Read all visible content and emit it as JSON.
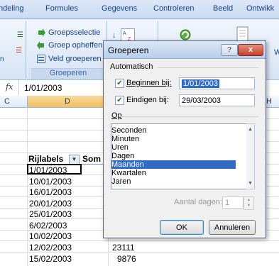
{
  "ribbon": {
    "tabs": [
      "ndeling",
      "Formules",
      "Gegevens",
      "Controleren",
      "Beeld",
      "Ontwikk"
    ],
    "buttons": {
      "groepsselectie": "Groepsselectie",
      "groep_opheffen": "Groep opheffen",
      "veld_groeperen": "Veld groeperen"
    },
    "group_label": "Groeperen",
    "partial_label_right": "W"
  },
  "formula_bar": {
    "fx": "fx",
    "value": "1/01/2003"
  },
  "sheet": {
    "columns": [
      "C",
      "D",
      "H"
    ],
    "pivot_header": {
      "row_labels": "Rijlabels",
      "sum": "Som"
    },
    "dates": [
      "1/01/2003",
      "10/01/2003",
      "16/01/2003",
      "20/01/2003",
      "25/01/2003",
      "6/02/2003",
      "10/02/2003",
      "12/02/2003",
      "15/02/2003"
    ],
    "values_visible": [
      "23111",
      "9876"
    ]
  },
  "dialog": {
    "title": "Groeperen",
    "help": "?",
    "close": "x",
    "section_auto": "Automatisch",
    "begin_label": "Beginnen bij:",
    "begin_value": "1/01/2003",
    "begin_checked": true,
    "end_label": "Eindigen bij:",
    "end_value": "29/03/2003",
    "end_checked": true,
    "section_by": "Op",
    "list_items": [
      "Seconden",
      "Minuten",
      "Uren",
      "Dagen",
      "Maanden",
      "Kwartalen",
      "Jaren"
    ],
    "selected_item": "Maanden",
    "days_label": "Aantal dagen:",
    "days_value": "1",
    "ok": "OK",
    "cancel": "Annuleren"
  }
}
